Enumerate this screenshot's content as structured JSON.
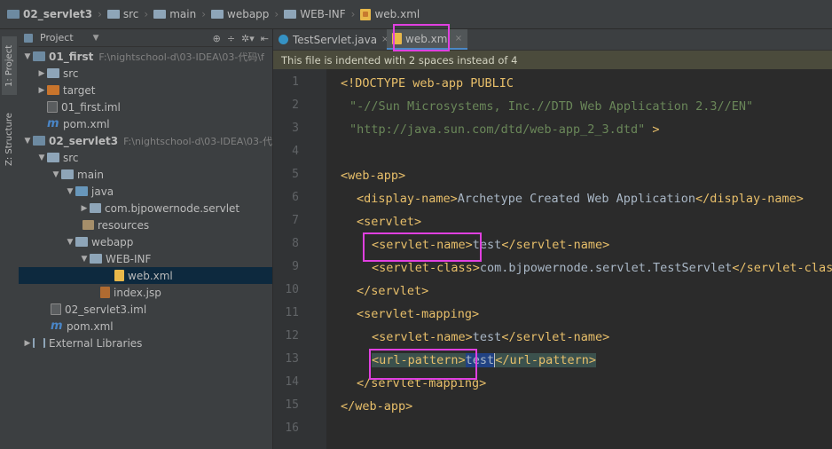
{
  "breadcrumb": [
    "02_servlet3",
    "src",
    "main",
    "webapp",
    "WEB-INF",
    "web.xml"
  ],
  "tool_strip": {
    "project_tab": "1: Project",
    "structure_tab": "Z: Structure"
  },
  "project_panel": {
    "title": "Project",
    "items": [
      {
        "label": "01_first",
        "path": "F:\\nightschool-d\\03-IDEA\\03-代码\\f",
        "kind": "module"
      },
      {
        "label": "src",
        "kind": "folder"
      },
      {
        "label": "target",
        "kind": "folder-orange"
      },
      {
        "label": "01_first.iml",
        "kind": "iml"
      },
      {
        "label": "pom.xml",
        "kind": "maven"
      },
      {
        "label": "02_servlet3",
        "path": "F:\\nightschool-d\\03-IDEA\\03-代",
        "kind": "module"
      },
      {
        "label": "src",
        "kind": "folder"
      },
      {
        "label": "main",
        "kind": "folder"
      },
      {
        "label": "java",
        "kind": "folder-blue"
      },
      {
        "label": "com.bjpowernode.servlet",
        "kind": "pkg"
      },
      {
        "label": "resources",
        "kind": "res"
      },
      {
        "label": "webapp",
        "kind": "folder"
      },
      {
        "label": "WEB-INF",
        "kind": "folder"
      },
      {
        "label": "web.xml",
        "kind": "xml"
      },
      {
        "label": "index.jsp",
        "kind": "jsp"
      },
      {
        "label": "02_servlet3.iml",
        "kind": "iml"
      },
      {
        "label": "pom.xml",
        "kind": "maven"
      },
      {
        "label": "External Libraries",
        "kind": "libs"
      }
    ]
  },
  "tabs": [
    {
      "label": "TestServlet.java",
      "active": false
    },
    {
      "label": "web.xml",
      "active": true
    }
  ],
  "notice": "This file is indented with 2 spaces instead of 4",
  "line_numbers": [
    "1",
    "2",
    "3",
    "4",
    "5",
    "6",
    "7",
    "8",
    "9",
    "10",
    "11",
    "12",
    "13",
    "14",
    "15",
    "16"
  ],
  "code": {
    "l1": "<!DOCTYPE web-app PUBLIC",
    "l2": "\"-//Sun Microsystems, Inc.//DTD Web Application 2.3//EN\"",
    "l3a": "\"http://java.sun.com/dtd/web-app_2_3.dtd\"",
    "l3b": " >",
    "l5": "<web-app>",
    "l6a": "<display-name>",
    "l6b": "Archetype Created Web Application",
    "l6c": "</display-name>",
    "l7": "<servlet>",
    "l8a": "<servlet-name>",
    "l8b": "test",
    "l8c": "</servlet-name>",
    "l9a": "<servlet-class>",
    "l9b": "com.bjpowernode.servlet.TestServlet",
    "l9c": "</servlet-class>",
    "l10": "</servlet>",
    "l11": "<servlet-mapping>",
    "l12a": "<servlet-name>",
    "l12b": "test",
    "l12c": "</servlet-name>",
    "l13a": "<url-pattern>",
    "l13b": "test",
    "l13c": "</url-pattern>",
    "l14": "</servlet-mapping>",
    "l15": "</web-app>"
  },
  "colors": {
    "tag": "#e8bf6a",
    "text": "#a9b7c6",
    "string": "#6a8759",
    "highlight_box": "#e040e0",
    "selection": "#214283"
  }
}
